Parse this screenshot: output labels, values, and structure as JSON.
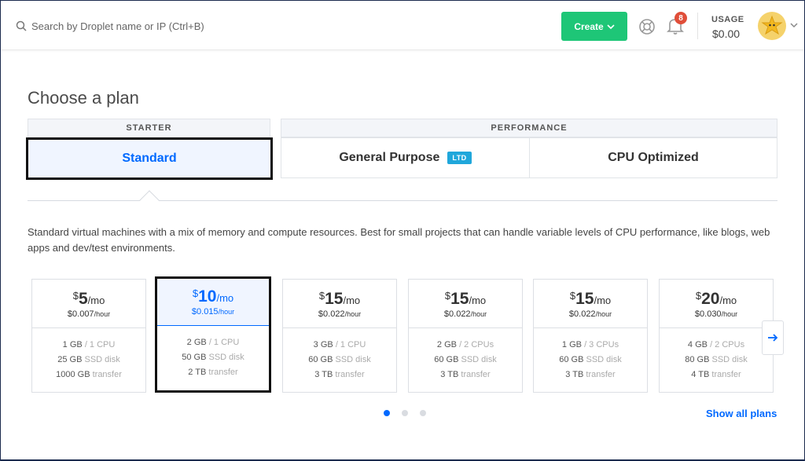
{
  "search": {
    "placeholder": "Search by Droplet name or IP (Ctrl+B)"
  },
  "header": {
    "create_label": "Create",
    "notification_count": "8",
    "usage_label": "USAGE",
    "usage_value": "$0.00"
  },
  "page": {
    "title": "Choose a plan",
    "groups": {
      "starter": "STARTER",
      "performance": "PERFORMANCE"
    },
    "tabs": [
      {
        "label": "Standard",
        "active": true
      },
      {
        "label": "General Purpose",
        "badge": "LTD",
        "active": false
      },
      {
        "label": "CPU Optimized",
        "active": false
      }
    ],
    "description": "Standard virtual machines with a mix of memory and compute resources. Best for small projects that can handle variable levels of CPU performance, like blogs, web apps and dev/test environments."
  },
  "plans": [
    {
      "dollar": "$",
      "amount": "5",
      "per": "/mo",
      "hourly": "$0.007",
      "hour_unit": "/hour",
      "mem": "1 GB",
      "cpu": "/ 1 CPU",
      "disk": "25 GB",
      "disk_unit": "SSD disk",
      "transfer": "1000 GB",
      "transfer_unit": "transfer",
      "selected": false
    },
    {
      "dollar": "$",
      "amount": "10",
      "per": "/mo",
      "hourly": "$0.015",
      "hour_unit": "/hour",
      "mem": "2 GB",
      "cpu": "/ 1 CPU",
      "disk": "50 GB",
      "disk_unit": "SSD disk",
      "transfer": "2 TB",
      "transfer_unit": "transfer",
      "selected": true
    },
    {
      "dollar": "$",
      "amount": "15",
      "per": "/mo",
      "hourly": "$0.022",
      "hour_unit": "/hour",
      "mem": "3 GB",
      "cpu": "/ 1 CPU",
      "disk": "60 GB",
      "disk_unit": "SSD disk",
      "transfer": "3 TB",
      "transfer_unit": "transfer",
      "selected": false
    },
    {
      "dollar": "$",
      "amount": "15",
      "per": "/mo",
      "hourly": "$0.022",
      "hour_unit": "/hour",
      "mem": "2 GB",
      "cpu": "/ 2 CPUs",
      "disk": "60 GB",
      "disk_unit": "SSD disk",
      "transfer": "3 TB",
      "transfer_unit": "transfer",
      "selected": false
    },
    {
      "dollar": "$",
      "amount": "15",
      "per": "/mo",
      "hourly": "$0.022",
      "hour_unit": "/hour",
      "mem": "1 GB",
      "cpu": "/ 3 CPUs",
      "disk": "60 GB",
      "disk_unit": "SSD disk",
      "transfer": "3 TB",
      "transfer_unit": "transfer",
      "selected": false
    },
    {
      "dollar": "$",
      "amount": "20",
      "per": "/mo",
      "hourly": "$0.030",
      "hour_unit": "/hour",
      "mem": "4 GB",
      "cpu": "/ 2 CPUs",
      "disk": "80 GB",
      "disk_unit": "SSD disk",
      "transfer": "4 TB",
      "transfer_unit": "transfer",
      "selected": false
    }
  ],
  "pagination": {
    "pages": 3,
    "current": 1
  },
  "show_all_label": "Show all plans",
  "colors": {
    "accent": "#0069ff",
    "create": "#1ec677",
    "badge": "#e04e39",
    "ltd": "#20a7db"
  },
  "icons": [
    "search-icon",
    "chevron-down-icon",
    "support-icon",
    "bell-icon",
    "avatar",
    "arrow-right-icon"
  ]
}
